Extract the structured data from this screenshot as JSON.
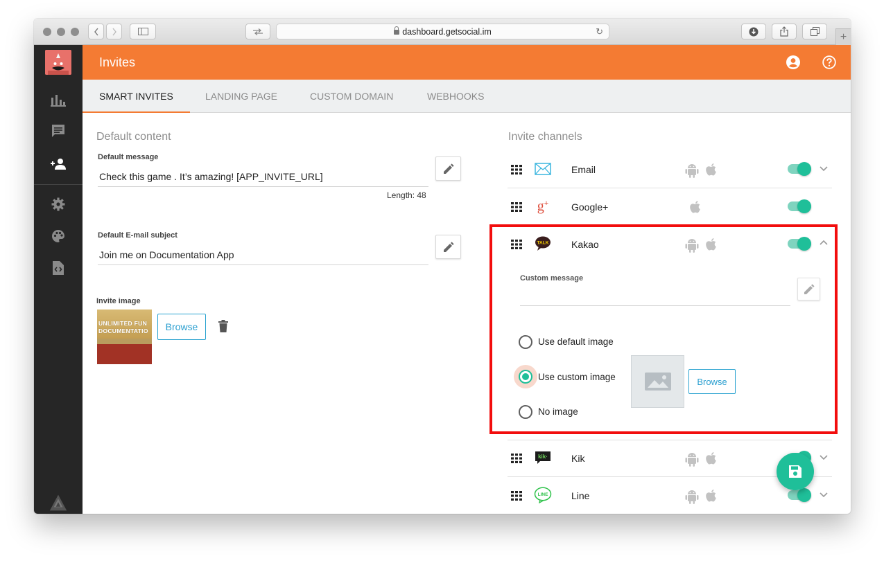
{
  "browser": {
    "url": "dashboard.getsocial.im"
  },
  "header": {
    "title": "Invites"
  },
  "tabs": [
    {
      "label": "SMART INVITES"
    },
    {
      "label": "LANDING PAGE"
    },
    {
      "label": "CUSTOM DOMAIN"
    },
    {
      "label": "WEBHOOKS"
    }
  ],
  "default_content": {
    "section_title": "Default content",
    "message_label": "Default message",
    "message_value": "Check this game . It’s amazing! [APP_INVITE_URL]",
    "length_text": "Length: 48",
    "email_subject_label": "Default E-mail subject",
    "email_subject_value": "Join me on Documentation App",
    "invite_image_label": "Invite image",
    "image_text_line1": "UNLIMITED FUN",
    "image_text_line2": "DOCUMENTATIO",
    "browse_label": "Browse"
  },
  "channels": {
    "section_title": "Invite channels",
    "items": [
      {
        "name": "Email",
        "icon": "email-icon",
        "android": true,
        "ios": true,
        "enabled": true,
        "expanded": false
      },
      {
        "name": "Google+",
        "icon": "google-plus-icon",
        "android": false,
        "ios": true,
        "enabled": true,
        "expanded": false
      },
      {
        "name": "Kakao",
        "icon": "kakao-talk-icon",
        "android": true,
        "ios": true,
        "enabled": true,
        "expanded": true
      },
      {
        "name": "Kik",
        "icon": "kik-icon",
        "android": true,
        "ios": true,
        "enabled": true,
        "expanded": false
      },
      {
        "name": "Line",
        "icon": "line-icon",
        "android": true,
        "ios": true,
        "enabled": true,
        "expanded": false
      }
    ],
    "kakao_panel": {
      "custom_message_label": "Custom message",
      "custom_message_value": "",
      "image_options": [
        {
          "label": "Use default image",
          "selected": false
        },
        {
          "label": "Use custom image",
          "selected": true
        },
        {
          "label": "No image",
          "selected": false
        }
      ],
      "browse_label": "Browse"
    }
  },
  "colors": {
    "accent_orange": "#f47b33",
    "toggle_green": "#1fbf99",
    "highlight_red": "#f20d0d",
    "link_blue": "#2a9fd0",
    "sidebar_bg": "#262626"
  }
}
